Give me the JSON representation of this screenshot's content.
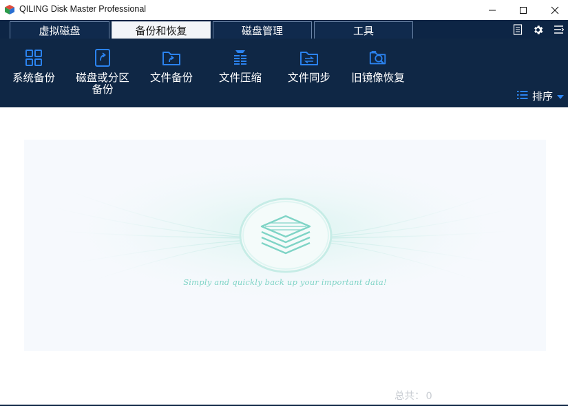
{
  "window": {
    "title": "QILING Disk Master Professional"
  },
  "tabs": [
    {
      "label": "虚拟磁盘",
      "active": false
    },
    {
      "label": "备份和恢复",
      "active": true
    },
    {
      "label": "磁盘管理",
      "active": false
    },
    {
      "label": "工具",
      "active": false
    }
  ],
  "tab_icons": [
    "log-icon",
    "gear-icon",
    "menu-icon"
  ],
  "toolbar": {
    "items": [
      {
        "label": "系统备份",
        "icon": "system-backup-icon"
      },
      {
        "label": "磁盘或分区",
        "label2": "备份",
        "icon": "disk-partition-backup-icon"
      },
      {
        "label": "文件备份",
        "icon": "file-backup-icon"
      },
      {
        "label": "文件压缩",
        "icon": "file-compress-icon"
      },
      {
        "label": "文件同步",
        "icon": "file-sync-icon"
      },
      {
        "label": "旧镜像恢复",
        "icon": "old-image-restore-icon"
      }
    ],
    "sort_label": "排序"
  },
  "main": {
    "tagline": "Simply and quickly back up your important data!",
    "total_label": "总共：",
    "total_value": "0"
  },
  "colors": {
    "dark_navy": "#0f2745",
    "accent_blue": "#1e6fd9",
    "mint": "#7fd4c6"
  }
}
